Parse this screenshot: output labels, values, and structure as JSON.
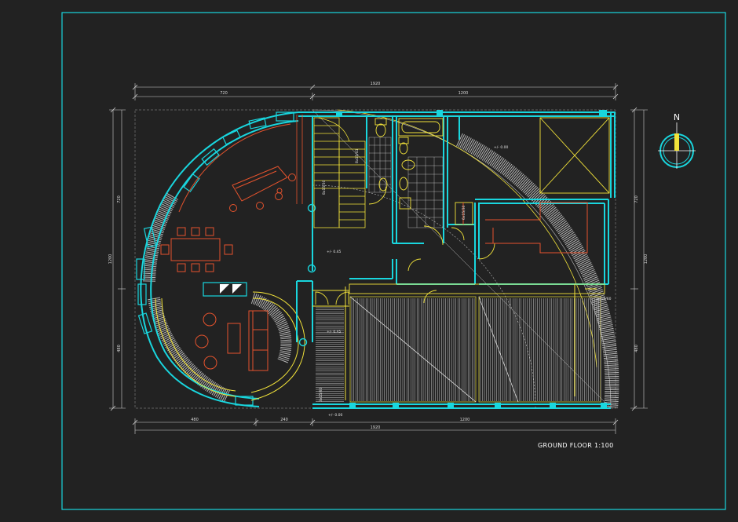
{
  "sheet": {
    "title": "GROUND FLOOR 1:100",
    "north_label": "N",
    "icon": "north-arrow-icon"
  },
  "dimensions": {
    "top_overall": "1920",
    "top_left": "720",
    "top_right": "1200",
    "bottom_left": "480",
    "bottom_mid": "240",
    "bottom_right": "1200",
    "bottom_overall": "1920",
    "left_top": "720",
    "left_overall": "1200",
    "left_bottom": "480",
    "right_top": "720",
    "right_overall": "1200",
    "right_bottom": "480"
  },
  "annotations": {
    "level_garage": "+/- 0.00",
    "level_living": "+/- 0.45",
    "level_entry": "+/- 0.45",
    "level_bottom": "+/- 0.00",
    "stair_main": "8x15/41",
    "stair_small": "8x15/30",
    "stair_hall": "6x15/30",
    "stair_entry": "3x15/80",
    "stair_ramp": "3x15/60"
  },
  "colors": {
    "background": "#222222",
    "frame": "#19d6de",
    "walls": "#19d6de",
    "yellow": "#f2e33a",
    "orange": "#e5532d",
    "white": "#e8e8e8"
  }
}
